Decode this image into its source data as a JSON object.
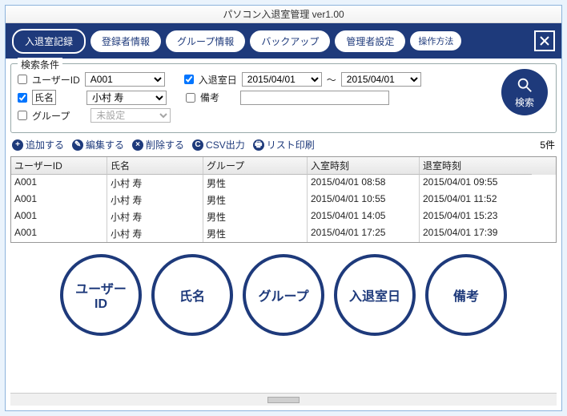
{
  "title": "パソコン入退室管理 ver1.00",
  "nav": {
    "records": "入退室記録",
    "registrants": "登録者情報",
    "groups": "グループ情報",
    "backup": "バックアップ",
    "admin": "管理者設定",
    "help": "操作方法"
  },
  "search": {
    "legend": "検索条件",
    "user_id_label": "ユーザーID",
    "user_id_value": "A001",
    "name_label": "氏名",
    "name_value": "小村 寿",
    "group_label": "グループ",
    "group_value": "未設定",
    "date_label": "入退室日",
    "date_from": "2015/04/01",
    "date_sep": "～",
    "date_to": "2015/04/01",
    "remarks_label": "備考",
    "remarks_value": "",
    "button": "検索"
  },
  "toolbar": {
    "add": "追加する",
    "edit": "編集する",
    "delete": "削除する",
    "csv": "CSV出力",
    "print": "リスト印刷",
    "count": "5件"
  },
  "table": {
    "headers": {
      "user_id": "ユーザーID",
      "name": "氏名",
      "group": "グループ",
      "enter": "入室時刻",
      "exit": "退室時刻"
    },
    "rows": [
      {
        "user_id": "A001",
        "name": "小村 寿",
        "group": "男性",
        "enter": "2015/04/01 08:58",
        "exit": "2015/04/01 09:55"
      },
      {
        "user_id": "A001",
        "name": "小村 寿",
        "group": "男性",
        "enter": "2015/04/01 10:55",
        "exit": "2015/04/01 11:52"
      },
      {
        "user_id": "A001",
        "name": "小村 寿",
        "group": "男性",
        "enter": "2015/04/01 14:05",
        "exit": "2015/04/01 15:23"
      },
      {
        "user_id": "A001",
        "name": "小村 寿",
        "group": "男性",
        "enter": "2015/04/01 17:25",
        "exit": "2015/04/01 17:39"
      }
    ]
  },
  "circles": {
    "user_id": "ユーザー\nID",
    "name": "氏名",
    "group": "グループ",
    "date": "入退室日",
    "remarks": "備考"
  }
}
